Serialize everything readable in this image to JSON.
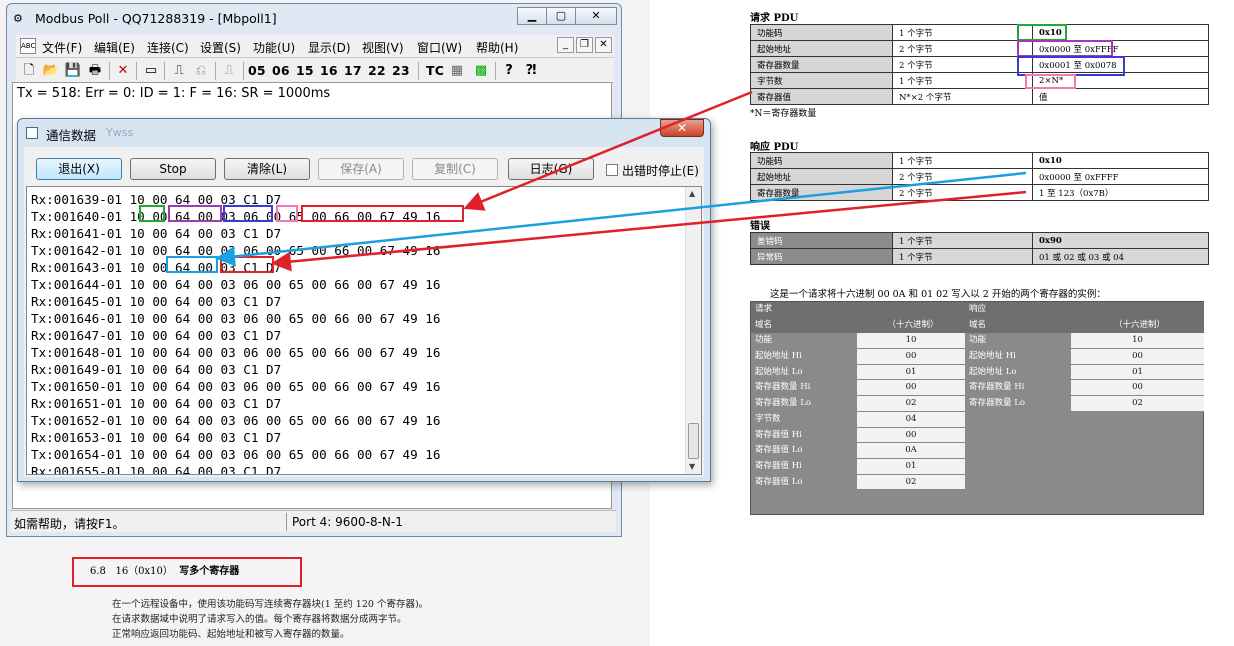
{
  "doc": {
    "section_num": "6.8",
    "section_code": "16（0x10）",
    "section_title": "写多个寄存器",
    "paragraph": [
      "在一个远程设备中，使用该功能码写连续寄存器块(1 至约 120 个寄存器)。",
      "在请求数据域中说明了请求写入的值。每个寄存器将数据分成两字节。",
      "正常响应返回功能码、起始地址和被写入寄存器的数量。"
    ],
    "request_pdu": {
      "title": "请求 PDU",
      "rows": [
        [
          "功能码",
          "1 个字节",
          "0x10"
        ],
        [
          "起始地址",
          "2 个字节",
          "0x0000 至 0xFFFF"
        ],
        [
          "寄存器数量",
          "2 个字节",
          "0x0001 至 0x0078"
        ],
        [
          "字节数",
          "1 个字节",
          "2×N*"
        ],
        [
          "寄存器值",
          "N*×2 个字节",
          "值"
        ]
      ],
      "note": "*N＝寄存器数量"
    },
    "response_pdu": {
      "title": "响应 PDU",
      "rows": [
        [
          "功能码",
          "1 个字节",
          "0x10"
        ],
        [
          "起始地址",
          "2 个字节",
          "0x0000 至 0xFFFF"
        ],
        [
          "寄存器数量",
          "2 个字节",
          "1 至 123（0x7B）"
        ]
      ]
    },
    "error_pdu": {
      "title": "错误",
      "rows": [
        [
          "差错码",
          "1 个字节",
          "0x90"
        ],
        [
          "异常码",
          "1 个字节",
          "01 或 02 或 03 或 04"
        ]
      ]
    },
    "example": {
      "caption": "这是一个请求将十六进制 00 0A 和 01 02 写入以 2 开始的两个寄存器的实例：",
      "request_header": "请求",
      "response_header": "响应",
      "field_header": "域名",
      "hex_header": "（十六进制）",
      "request_fields": [
        "功能",
        "起始地址 Hi",
        "起始地址 Lo",
        "寄存器数量 Hi",
        "寄存器数量 Lo",
        "字节数",
        "寄存器值 Hi",
        "寄存器值 Lo",
        "寄存器值 Hi",
        "寄存器值 Lo"
      ],
      "request_values": [
        "10",
        "00",
        "01",
        "00",
        "02",
        "04",
        "00",
        "0A",
        "01",
        "02"
      ],
      "response_fields": [
        "功能",
        "起始地址 Hi",
        "起始地址 Lo",
        "寄存器数量 Hi",
        "寄存器数量 Lo"
      ],
      "response_values": [
        "10",
        "00",
        "01",
        "00",
        "02"
      ]
    }
  },
  "main_window": {
    "title": "Modbus Poll - QQ71288319 - [Mbpoll1]",
    "menu": [
      "文件(F)",
      "编辑(E)",
      "连接(C)",
      "设置(S)",
      "功能(U)",
      "显示(D)",
      "视图(V)",
      "窗口(W)",
      "帮助(H)"
    ],
    "toolbar_codes": [
      "05",
      "06",
      "15",
      "16",
      "17",
      "22",
      "23"
    ],
    "toolbar_tc": "TC",
    "status_line": "Tx = 518: Err = 0: ID = 1: F = 16: SR = 1000ms",
    "statusbar_left": "如需帮助，请按F1。",
    "statusbar_right": "Port 4: 9600-8-N-1"
  },
  "dialog": {
    "title": "通信数据",
    "ghost_title": "Ywss",
    "buttons": {
      "exit": "退出(X)",
      "stop": "Stop",
      "clear": "清除(L)",
      "save": "保存(A)",
      "copy": "复制(C)",
      "log": "日志(G)"
    },
    "checkbox_label": "出错时停止(E)",
    "log_lines": [
      "Rx:001639-01 10 00 64 00 03 C1 D7",
      "Tx:001640-01 10 00 64 00 03 06 00 65 00 66 00 67 49 16",
      "Rx:001641-01 10 00 64 00 03 C1 D7",
      "Tx:001642-01 10 00 64 00 03 06 00 65 00 66 00 67 49 16",
      "Rx:001643-01 10 00 64 00 03 C1 D7",
      "Tx:001644-01 10 00 64 00 03 06 00 65 00 66 00 67 49 16",
      "Rx:001645-01 10 00 64 00 03 C1 D7",
      "Tx:001646-01 10 00 64 00 03 06 00 65 00 66 00 67 49 16",
      "Rx:001647-01 10 00 64 00 03 C1 D7",
      "Tx:001648-01 10 00 64 00 03 06 00 65 00 66 00 67 49 16",
      "Rx:001649-01 10 00 64 00 03 C1 D7",
      "Tx:001650-01 10 00 64 00 03 06 00 65 00 66 00 67 49 16",
      "Rx:001651-01 10 00 64 00 03 C1 D7",
      "Tx:001652-01 10 00 64 00 03 06 00 65 00 66 00 67 49 16",
      "Rx:001653-01 10 00 64 00 03 C1 D7",
      "Tx:001654-01 10 00 64 00 03 06 00 65 00 66 00 67 49 16",
      "Rx:001655-01 10 00 64 00 03 C1 D7"
    ]
  },
  "colors": {
    "annotation_red": "#e0202a",
    "annotation_green": "#22a83a",
    "annotation_purple": "#a23ab8",
    "annotation_blue": "#3a3ad0",
    "annotation_pink": "#f07ab0",
    "annotation_cyan": "#1a9fe0"
  }
}
